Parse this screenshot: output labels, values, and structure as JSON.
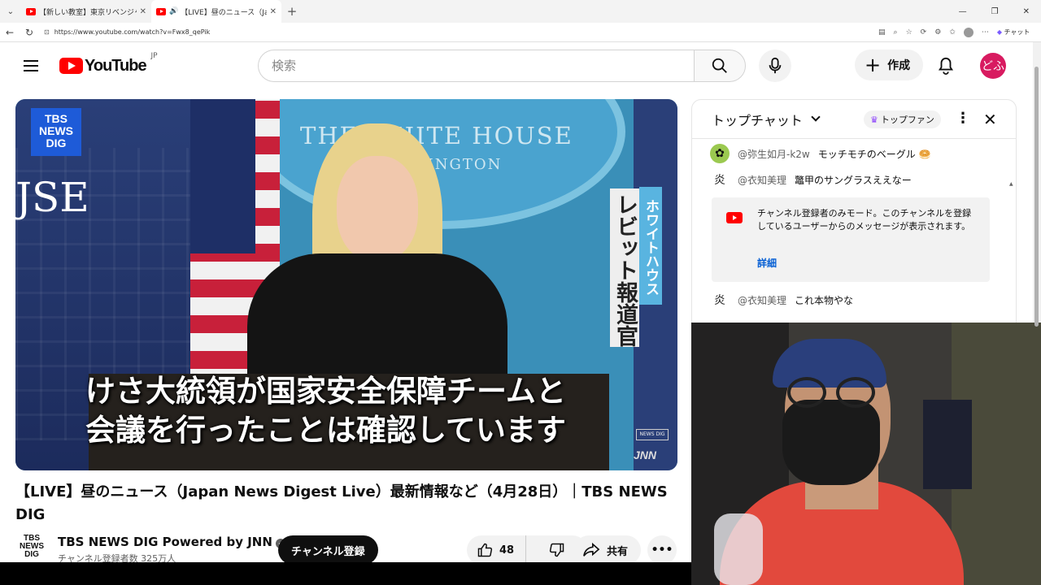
{
  "browser": {
    "tabs": [
      {
        "title": "【新しい教室】東京リベンジャーズ【映"
      },
      {
        "title": "【LIVE】昼のニュース（Japan News"
      }
    ],
    "address": "https://www.youtube.com/watch?v=Fwx8_qePik",
    "copilot_label": "チャット"
  },
  "masthead": {
    "logo_text": "YouTube",
    "country_code": "JP",
    "search_placeholder": "検索",
    "create_label": "作成",
    "avatar_text": "どふ",
    "brand_color": "#ff0000"
  },
  "player": {
    "channel_badge": "TBS NEWS DIG",
    "backdrop_title": "THE WHITE HOUSE",
    "backdrop_sub": "WASHINGTON",
    "backdrop_fragment": "JSE",
    "caption_name": "レビット報道官",
    "caption_role": "ホワイトハウス",
    "subtitle_line1": "けさ大統領が国家安全保障チームと",
    "subtitle_line2": "会議を行ったことは確認しています",
    "network_mark": "JNN",
    "mini_logo": "NEWS DIG"
  },
  "video": {
    "title": "【LIVE】昼のニュース（Japan News Digest Live）最新情報など（4月28日）｜TBS NEWS DIG",
    "channel_logo": "TBS NEWS DIG",
    "channel_name": "TBS NEWS DIG Powered by JNN",
    "subscribers": "チャンネル登録者数 325万人",
    "subscribe_label": "チャンネル登録",
    "like_count": "48",
    "share_label": "共有"
  },
  "chat": {
    "mode_label": "トップチャット",
    "fan_label": "トップファン",
    "messages": [
      {
        "author": "@弥生如月-k2w",
        "text": "モッチモチのベーグル 🥯"
      },
      {
        "author": "@衣知美理",
        "text": "鼈甲のサングラスええなー"
      },
      {
        "author": "@衣知美理",
        "text": "これ本物やな"
      }
    ],
    "notice_text": "チャンネル登録者のみモード。このチャンネルを登録しているユーザーからのメッセージが表示されます。",
    "notice_link": "詳細"
  }
}
